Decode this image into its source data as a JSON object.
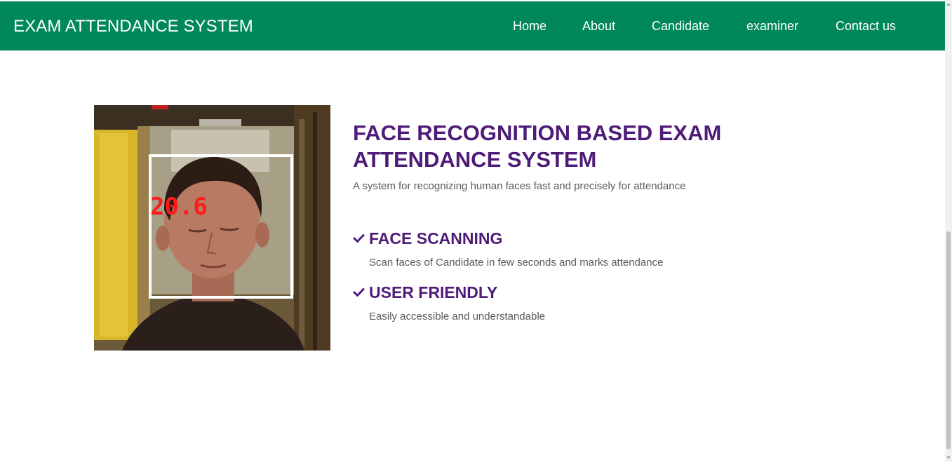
{
  "navbar": {
    "brand": "EXAM ATTENDANCE SYSTEM",
    "items": [
      "Home",
      "About",
      "Candidate",
      "examiner",
      "Contact us"
    ],
    "background": "#00875a"
  },
  "hero": {
    "image": {
      "overlay_label": "20.6",
      "overlay_color": "#ff1a1a"
    },
    "title": "FACE RECOGNITION BASED EXAM ATTENDANCE SYSTEM",
    "subtitle": "A system for recognizing human faces fast and precisely for attendance",
    "features": [
      {
        "icon": "check-icon",
        "title": "FACE SCANNING",
        "description": "Scan faces of Candidate in few seconds and marks attendance"
      },
      {
        "icon": "check-icon",
        "title": "USER FRIENDLY",
        "description": "Easily accessible and understandable"
      }
    ]
  },
  "colors": {
    "heading": "#4e1c78",
    "body_text": "#5a5a5a"
  }
}
